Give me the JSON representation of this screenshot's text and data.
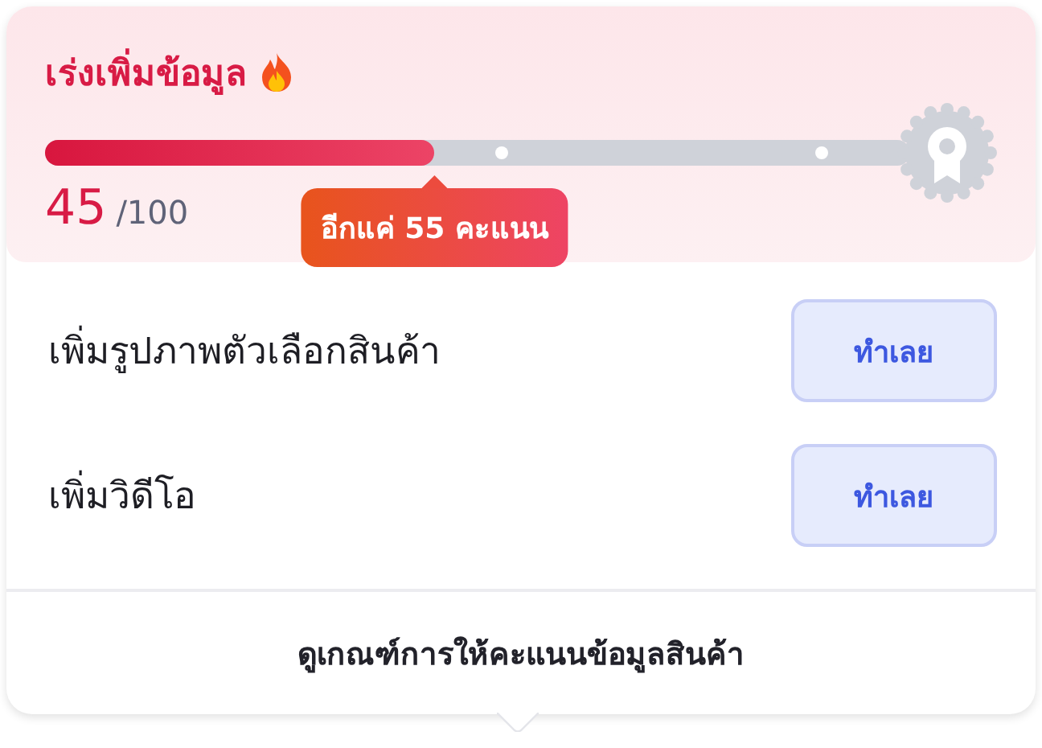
{
  "header": {
    "title": "เร่งเพิ่มข้อมูล",
    "progress": {
      "level": 0.45
    },
    "score": "45",
    "total": "/100",
    "tooltip": "อีกแค่ 55 คะแนน"
  },
  "tasks": [
    {
      "label": "เพิ่มรูปภาพตัวเลือกสินค้า",
      "action": "ทำเลย"
    },
    {
      "label": "เพิ่มวิดีโอ",
      "action": "ทำเลย"
    }
  ],
  "footer_link": "ดูเกณฑ์การให้คะแนนข้อมูลสินค้า"
}
